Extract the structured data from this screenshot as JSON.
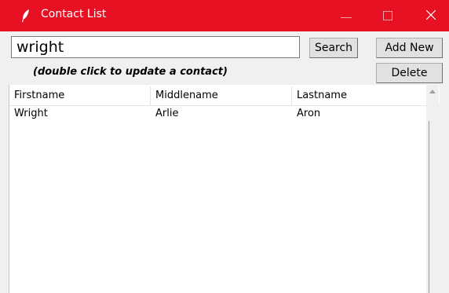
{
  "window": {
    "title": "Contact List",
    "colors": {
      "titlebar": "#e81123",
      "title_text": "#ffffff"
    }
  },
  "search": {
    "value": "wright",
    "button_label": "Search"
  },
  "actions": {
    "add_new_label": "Add New",
    "delete_label": "Delete"
  },
  "hint": "(double click to update a contact)",
  "table": {
    "columns": [
      "Firstname",
      "Middlename",
      "Lastname"
    ],
    "rows": [
      [
        "Wright",
        "Arlie",
        "Aron"
      ]
    ]
  }
}
